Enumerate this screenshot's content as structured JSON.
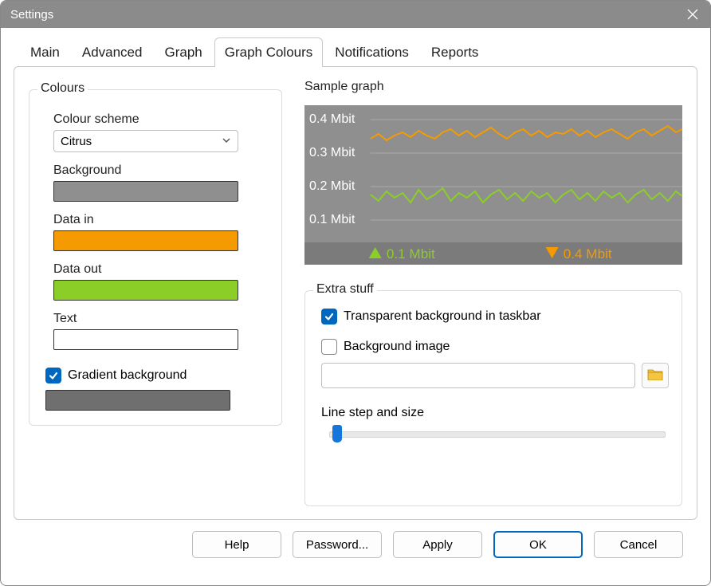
{
  "window": {
    "title": "Settings"
  },
  "tabs": [
    "Main",
    "Advanced",
    "Graph",
    "Graph Colours",
    "Notifications",
    "Reports"
  ],
  "active_tab_index": 3,
  "colours_group": {
    "legend": "Colours",
    "scheme_label": "Colour scheme",
    "scheme_value": "Citrus",
    "background_label": "Background",
    "background_colour": "#8f8f8f",
    "datain_label": "Data in",
    "datain_colour": "#f59a00",
    "dataout_label": "Data out",
    "dataout_colour": "#8bce28",
    "text_label": "Text",
    "text_colour": "#ffffff",
    "gradient_label": "Gradient background",
    "gradient_checked": true,
    "gradient_colour": "#6f6f6f"
  },
  "sample": {
    "title": "Sample graph",
    "ticks": [
      "0.4 Mbit",
      "0.3 Mbit",
      "0.2 Mbit",
      "0.1 Mbit"
    ],
    "legend_up": "0.1 Mbit",
    "legend_down": "0.4 Mbit",
    "up_colour": "#8bce28",
    "down_colour": "#f59a00"
  },
  "extra": {
    "legend": "Extra stuff",
    "transparent_label": "Transparent background in taskbar",
    "transparent_checked": true,
    "bgimage_label": "Background image",
    "bgimage_checked": false,
    "bgimage_path": "",
    "line_step_label": "Line step and size"
  },
  "buttons": {
    "help": "Help",
    "password": "Password...",
    "apply": "Apply",
    "ok": "OK",
    "cancel": "Cancel"
  },
  "chart_data": {
    "type": "line",
    "ylabel": "Mbit",
    "ylim": [
      0,
      0.45
    ],
    "yticks": [
      0.1,
      0.2,
      0.3,
      0.4
    ],
    "series": [
      {
        "name": "Data in (download)",
        "colour": "#f59a00",
        "approx_mean": 0.36,
        "approx_range": [
          0.32,
          0.42
        ],
        "legend_value": "0.4 Mbit"
      },
      {
        "name": "Data out (upload)",
        "colour": "#8bce28",
        "approx_mean": 0.16,
        "approx_range": [
          0.12,
          0.21
        ],
        "legend_value": "0.1 Mbit"
      }
    ],
    "note": "Sample preview showing two noisy horizontal traces; exact per-sample values are not labeled in the UI."
  }
}
